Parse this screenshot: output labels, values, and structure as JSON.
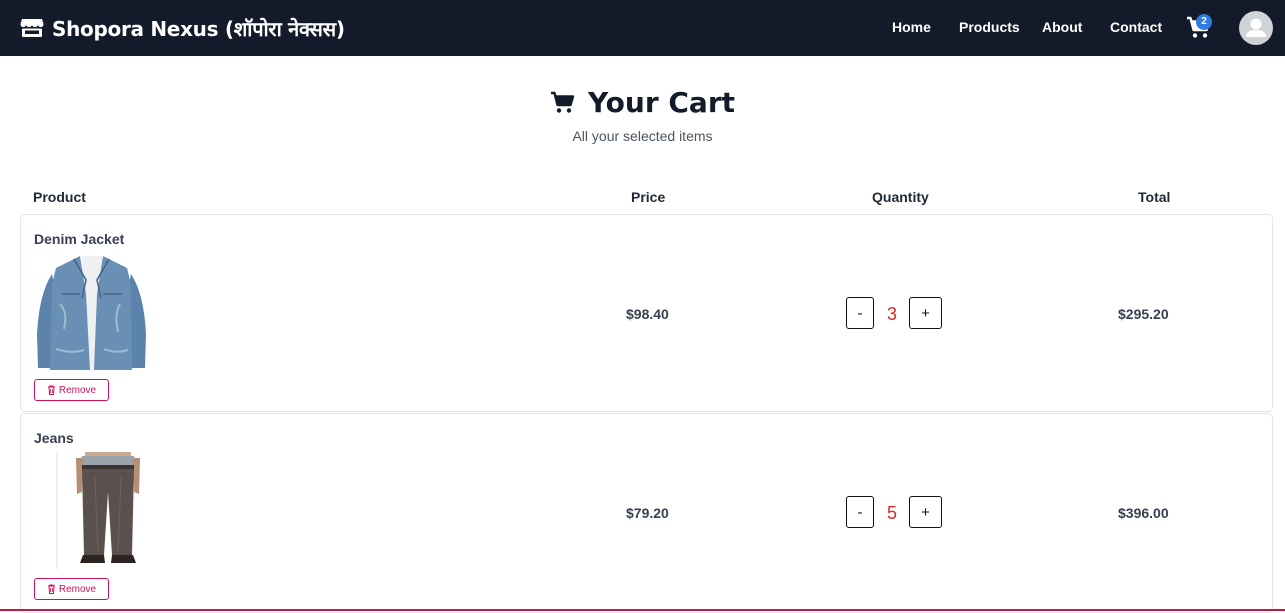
{
  "navbar": {
    "brand": "Shopora Nexus (शॉपोरा नेक्सस)",
    "links": [
      "Home",
      "Products",
      "About",
      "Contact"
    ],
    "cart_count": "2"
  },
  "header": {
    "title": "Your Cart",
    "subtitle": "All your selected items"
  },
  "table": {
    "columns": [
      "Product",
      "Price",
      "Quantity",
      "Total"
    ],
    "rows": [
      {
        "name": "Denim Jacket",
        "price": "$98.40",
        "quantity": "3",
        "total": "$295.20",
        "remove_label": "Remove"
      },
      {
        "name": "Jeans",
        "price": "$79.20",
        "quantity": "5",
        "total": "$396.00",
        "remove_label": "Remove"
      }
    ]
  },
  "qty_controls": {
    "minus": "-",
    "plus": "+"
  },
  "colors": {
    "navbar_bg": "#131a2a",
    "badge": "#2f7de1",
    "remove": "#d0115a",
    "quantity": "#dc2626"
  }
}
